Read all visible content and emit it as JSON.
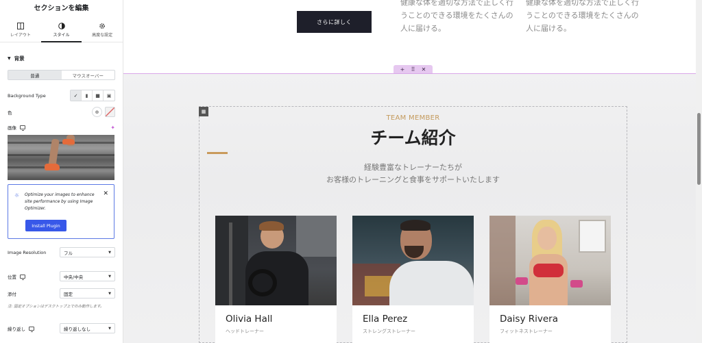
{
  "panel": {
    "title": "セクションを編集",
    "tabs": [
      {
        "label": "レイアウト",
        "icon": "layout-icon"
      },
      {
        "label": "スタイル",
        "icon": "contrast-icon"
      },
      {
        "label": "高度な設定",
        "icon": "gear-icon"
      }
    ],
    "active_tab": "スタイル",
    "section_title": "背景",
    "state_toggle": [
      "普通",
      "マウスオーバー"
    ],
    "background_type_label": "Background Type",
    "color_label": "色",
    "image_label": "画像",
    "notice": {
      "text": "Optimize your images to enhance site performance by using Image Optimizer.",
      "button": "Install Plugin"
    },
    "image_resolution": {
      "label": "Image Resolution",
      "value": "フル"
    },
    "position": {
      "label": "位置",
      "value": "中央/中央"
    },
    "attachment": {
      "label": "添付",
      "value": "固定"
    },
    "attachment_note": "注: 固定オプションはデスクトップ上でのみ動作します。",
    "repeat": {
      "label": "繰り返し",
      "value": "繰り返しなし"
    }
  },
  "canvas": {
    "top": {
      "button": "さらに詳しく",
      "text_left": "健康な体を適切な方法で正しく行うことのできる環境をたくさんの人に届ける。",
      "text_right": "健康な体を適切な方法で正しく行うことのできる環境をたくさんの人に届ける。"
    },
    "team": {
      "eyebrow": "TEAM MEMBER",
      "heading": "チーム紹介",
      "desc_line1": "経験豊富なトレーナーたちが",
      "desc_line2": "お客様のトレーニングと食事をサポートいたします",
      "members": [
        {
          "name": "Olivia Hall",
          "role": "ヘッドトレーナー"
        },
        {
          "name": "Ella Perez",
          "role": "ストレングストレーナー"
        },
        {
          "name": "Daisy Rivera",
          "role": "フィットネストレーナー"
        }
      ]
    }
  },
  "colors": {
    "accent_gold": "#c49a5c",
    "button_dark": "#1e1f2a",
    "plugin_blue": "#3858e9",
    "section_outline": "#d9a7e8"
  }
}
